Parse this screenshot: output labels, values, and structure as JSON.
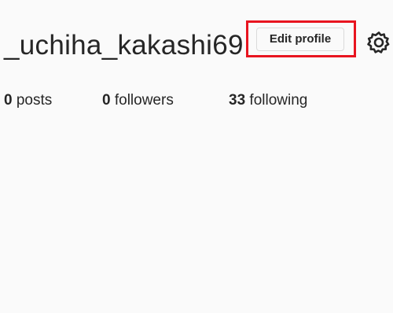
{
  "profile": {
    "username": "_uchiha_kakashi69",
    "edit_button_label": "Edit profile",
    "settings_icon": "gear-icon",
    "highlight_color": "#e8141f"
  },
  "stats": {
    "posts": {
      "count": "0",
      "label": "posts"
    },
    "followers": {
      "count": "0",
      "label": "followers"
    },
    "following": {
      "count": "33",
      "label": "following"
    }
  }
}
